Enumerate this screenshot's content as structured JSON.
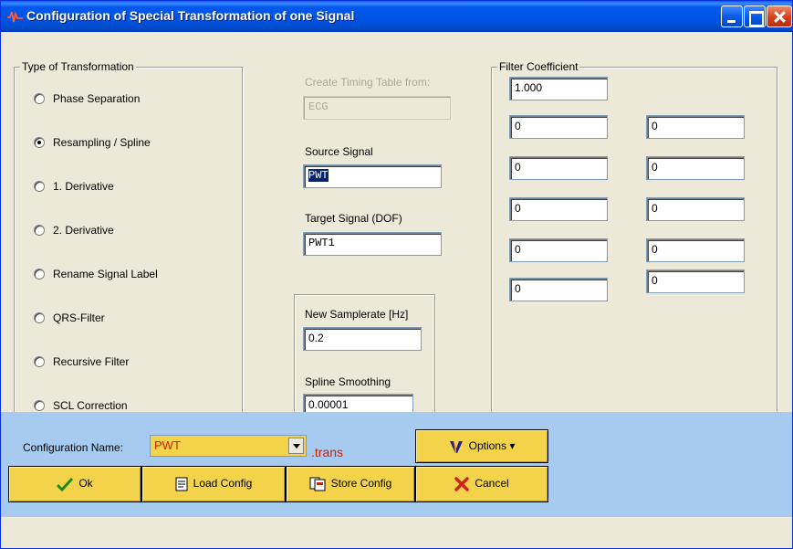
{
  "window": {
    "title": "Configuration of Special Transformation of one Signal"
  },
  "transformation": {
    "legend": "Type of Transformation",
    "selected_index": 1,
    "options": [
      "Phase Separation",
      "Resampling / Spline",
      "1. Derivative",
      "2. Derivative",
      "Rename Signal Label",
      "QRS-Filter",
      "Recursive Filter",
      "SCL Correction"
    ]
  },
  "timing": {
    "label": "Create Timing Table from:",
    "value": "ECG"
  },
  "source": {
    "label": "Source Signal",
    "value": "PWT"
  },
  "target": {
    "label": "Target Signal (DOF)",
    "value": "PWT1"
  },
  "resample": {
    "samplerate_label": "New Samplerate [Hz]",
    "samplerate_value": "0.2",
    "smoothing_label": "Spline Smoothing",
    "smoothing_value": "0.00001"
  },
  "filter": {
    "legend": "Filter Coefficient",
    "first": "1.000",
    "left": [
      "0",
      "0",
      "0",
      "0",
      "0"
    ],
    "right": [
      "0",
      "0",
      "0",
      "0",
      "0"
    ]
  },
  "config": {
    "name_label": "Configuration Name:",
    "name_value": "PWT",
    "extension": ".trans"
  },
  "buttons": {
    "options": "Options",
    "ok": "Ok",
    "load": "Load Config",
    "store": "Store Config",
    "cancel": "Cancel"
  },
  "colors": {
    "title_bar": "#0054e3",
    "dialog_bg": "#ece9d8",
    "bottom_bar": "#a6caf0",
    "button_bg": "#f2d34a",
    "extension_text": "#cc2200"
  },
  "icons": {
    "app": "waveform-icon",
    "ok": "checkmark-icon",
    "load": "document-icon",
    "store": "documents-icon",
    "cancel": "x-icon",
    "options": "v-logo-icon"
  }
}
